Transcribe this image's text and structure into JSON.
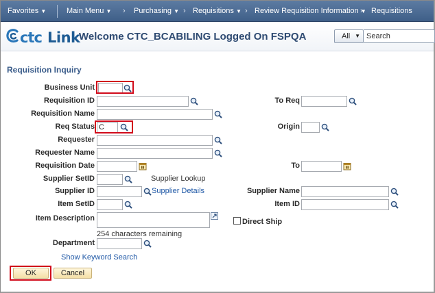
{
  "nav": {
    "favorites": "Favorites",
    "main_menu": "Main Menu",
    "purchasing": "Purchasing",
    "requisitions": "Requisitions",
    "review": "Review Requisition Information",
    "current": "Requisitions",
    "sep": "›"
  },
  "header": {
    "logo_ctc": "ctc",
    "logo_link": "Link",
    "welcome": "Welcome CTC_BCABILING Logged On FSPQA",
    "search_scope": "All",
    "search_placeholder": "Search"
  },
  "page": {
    "title": "Requisition Inquiry"
  },
  "form": {
    "business_unit": {
      "label": "Business Unit",
      "value": ""
    },
    "requisition_id": {
      "label": "Requisition ID",
      "value": ""
    },
    "to_req": {
      "label": "To Req",
      "value": ""
    },
    "requisition_name": {
      "label": "Requisition Name",
      "value": ""
    },
    "req_status": {
      "label": "Req Status",
      "value": "C"
    },
    "origin": {
      "label": "Origin",
      "value": ""
    },
    "requester": {
      "label": "Requester",
      "value": ""
    },
    "requester_name": {
      "label": "Requester Name",
      "value": ""
    },
    "requisition_date": {
      "label": "Requisition Date",
      "value": ""
    },
    "to_date": {
      "label": "To",
      "value": ""
    },
    "supplier_setid": {
      "label": "Supplier SetID",
      "value": ""
    },
    "supplier_lookup": "Supplier Lookup",
    "supplier_id": {
      "label": "Supplier ID",
      "value": ""
    },
    "supplier_details": "Supplier Details",
    "supplier_name": {
      "label": "Supplier Name",
      "value": ""
    },
    "item_setid": {
      "label": "Item SetID",
      "value": ""
    },
    "item_id": {
      "label": "Item ID",
      "value": ""
    },
    "item_description": {
      "label": "Item Description",
      "value": ""
    },
    "chars_remaining": "254 characters remaining",
    "direct_ship": "Direct Ship",
    "department": {
      "label": "Department",
      "value": ""
    },
    "keyword_search": "Show Keyword Search"
  },
  "buttons": {
    "ok": "OK",
    "cancel": "Cancel"
  },
  "colors": {
    "highlight": "#d10a1a",
    "nav_bg": "#4a6a93",
    "title": "#3a5c8a",
    "link": "#1f58a6"
  }
}
